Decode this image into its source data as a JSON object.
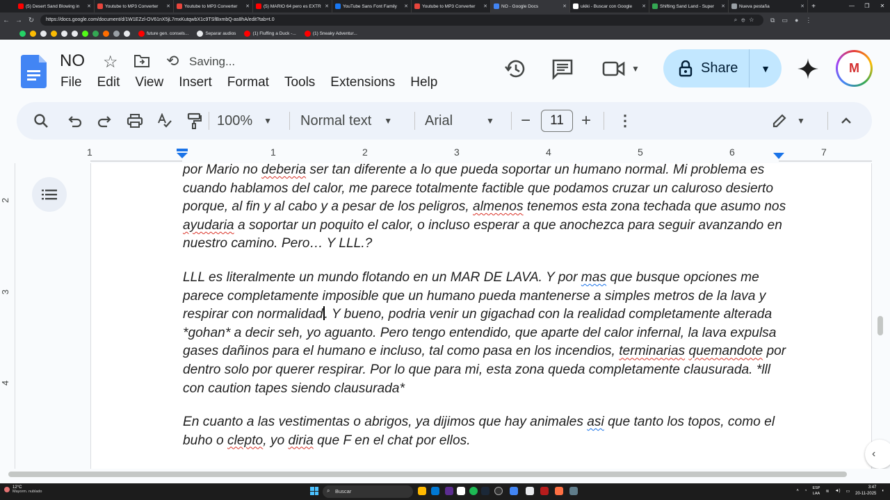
{
  "browser": {
    "tabs": [
      {
        "label": "(5) Desert Sand Blowing in",
        "color": "#ff0000"
      },
      {
        "label": "Youtube to MP3 Converter",
        "color": "#e8453c"
      },
      {
        "label": "Youtube to MP3 Converter",
        "color": "#e8453c"
      },
      {
        "label": "(5) MARIO 64 pero es EXTR",
        "color": "#ff0000"
      },
      {
        "label": "YouTube Sans Font Family",
        "color": "#1877f2"
      },
      {
        "label": "Youtube to MP3 Converter",
        "color": "#e8453c"
      },
      {
        "label": "NO - Google Docs",
        "color": "#4285f4"
      },
      {
        "label": "ukiki - Buscar con Google",
        "color": "#ffffff"
      },
      {
        "label": "Shifting Sand Land - Super",
        "color": "#34a853"
      },
      {
        "label": "Nueva pestaña",
        "color": "#9aa0a6"
      }
    ],
    "url": "https://docs.google.com/document/d/1W1EZzl-OV61nX5jL7mxKutqwbX1c9TSfBxmbQ-as8hA/edit?tab=t.0",
    "bookmarks": [
      "future gen. consels...",
      "Separar audios",
      "(1) Fluffing a Duck -...",
      "(1) Sneaky Adventur..."
    ]
  },
  "doc": {
    "title": "NO",
    "status": "Saving...",
    "menu": [
      "File",
      "Edit",
      "View",
      "Insert",
      "Format",
      "Tools",
      "Extensions",
      "Help"
    ],
    "share_label": "Share",
    "avatar_initial": "M",
    "accent": "#c2e7ff"
  },
  "toolbar": {
    "zoom": "100%",
    "style": "Normal text",
    "font": "Arial",
    "font_size": "11",
    "minus": "−",
    "plus": "+"
  },
  "ruler": {
    "top_numbers": [
      "1",
      "1",
      "2",
      "3",
      "4",
      "5",
      "6",
      "7"
    ],
    "side_numbers": [
      "2",
      "3",
      "4"
    ]
  },
  "body": {
    "p1_a": "por Mario no ",
    "p1_s1": "deberia",
    "p1_b": " ser tan diferente a lo que pueda soportar un humano normal. Mi problema es cuando hablamos del calor, me parece totalmente factible que podamos cruzar un caluroso desierto porque, al fin y al cabo y a pesar de los peligros, ",
    "p1_s2": "almenos",
    "p1_c": " tenemos esta zona techada que asumo nos ",
    "p1_s3": "ayudaria",
    "p1_d": " a soportar un poquito el calor, o incluso esperar a que anochezca para seguir avanzando en nuestro camino. Pero… Y LLL.?",
    "p2_a": "LLL es literalmente un mundo flotando en un MAR DE LAVA. Y por ",
    "p2_g1": "mas",
    "p2_b": " que busque opciones me parece completamente imposible que un humano pueda mantenerse a simples metros de la lava y respirar con normalidad",
    "p2_c": ". Y bueno, podria venir un gigachad con la realidad completamente alterada *gohan* a decir seh, yo aguanto. Pero tengo entendido, que aparte del calor infernal, la lava expulsa gases dañinos para el humano e incluso, tal como pasa en los incendios, ",
    "p2_s1": "terminarias",
    "p2_s2": "quemandote",
    "p2_d": " por dentro solo por querer respirar. Por lo que para mi, esta zona queda completamente clausurada. *lll con caution tapes siendo clausurada*",
    "p3_a": "En cuanto a las vestimentas o abrigos, ya dijimos que hay animales ",
    "p3_g1": "asi",
    "p3_b": " que tanto los topos, como el buho o ",
    "p3_s1": "clepto",
    "p3_c": ", yo ",
    "p3_s2": "diria",
    "p3_d": " que F en el chat por ellos."
  },
  "taskbar": {
    "temp": "12°C",
    "weather": "Mayorm. nublado",
    "search_placeholder": "Buscar",
    "lang_1": "ESP",
    "lang_2": "LAA",
    "time": "3:47",
    "date": "20-11-2025"
  }
}
